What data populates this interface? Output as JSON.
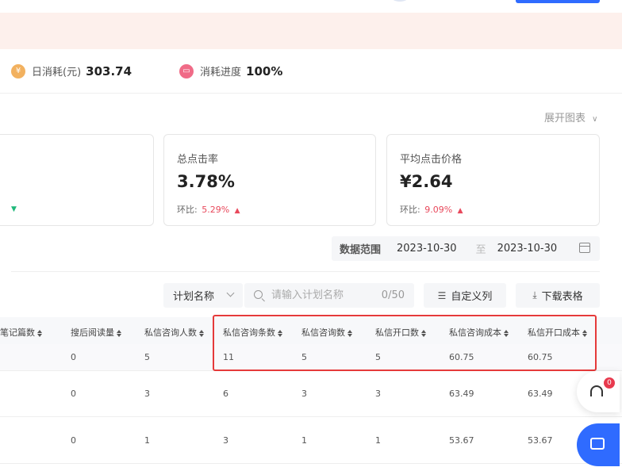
{
  "stats": [
    {
      "label": "日消耗(元)",
      "value": "303.74",
      "icon": "coin-icon",
      "color": "#f2b15f"
    },
    {
      "label": "消耗进度",
      "value": "100%",
      "icon": "progress-icon",
      "color": "#f06b87"
    }
  ],
  "expand_chart": "展开图表",
  "cards": [
    {
      "title": "总点击率",
      "value": "3.78%",
      "compare_label": "环比:",
      "compare_value": "5.29%"
    },
    {
      "title": "平均点击价格",
      "value": "¥2.64",
      "compare_label": "环比:",
      "compare_value": "9.09%"
    }
  ],
  "date_range": {
    "label": "数据范围",
    "start": "2023-10-30",
    "separator": "至",
    "end": "2023-10-30"
  },
  "toolbar": {
    "plan_select": "计划名称",
    "search_placeholder": "请输入计划名称",
    "search_count": "0/50",
    "custom_columns": "自定义列",
    "download": "下载表格"
  },
  "table": {
    "headers": [
      "笔记篇数",
      "搜后阅读量",
      "私信咨询人数",
      "私信咨询条数",
      "私信咨询数",
      "私信开口数",
      "私信咨询成本",
      "私信开口成本"
    ],
    "rows": [
      [
        "0",
        "5",
        "11",
        "5",
        "5",
        "60.75",
        "60.75"
      ],
      [
        "0",
        "3",
        "6",
        "3",
        "3",
        "63.49",
        "63.49"
      ],
      [
        "0",
        "1",
        "3",
        "1",
        "1",
        "53.67",
        "53.67"
      ]
    ]
  },
  "support_badge": "0"
}
